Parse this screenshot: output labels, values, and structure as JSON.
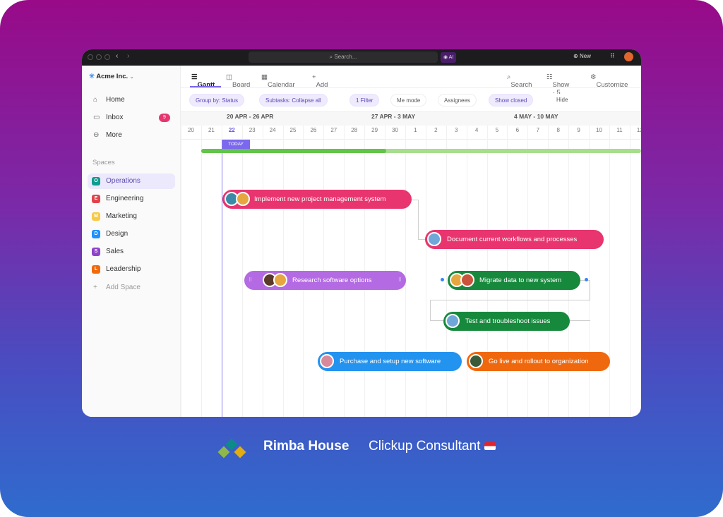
{
  "titlebar": {
    "search_placeholder": "Search...",
    "ai_label": "AI",
    "new_label": "New"
  },
  "workspace": {
    "name": "Acme Inc."
  },
  "nav": [
    {
      "label": "Home",
      "icon": "home-icon"
    },
    {
      "label": "Inbox",
      "icon": "inbox-icon",
      "badge": "9"
    },
    {
      "label": "More",
      "icon": "more-icon"
    }
  ],
  "spaces": {
    "heading": "Spaces",
    "items": [
      {
        "letter": "O",
        "label": "Operations",
        "color": "#0f9d8f",
        "active": true
      },
      {
        "letter": "E",
        "label": "Engineering",
        "color": "#e2434b"
      },
      {
        "letter": "M",
        "label": "Marketing",
        "color": "#f7c948"
      },
      {
        "letter": "D",
        "label": "Design",
        "color": "#1e90ff"
      },
      {
        "letter": "S",
        "label": "Sales",
        "color": "#8e44c9"
      },
      {
        "letter": "L",
        "label": "Leadership",
        "color": "#f06a0d"
      }
    ],
    "add_label": "Add Space"
  },
  "views": {
    "tabs": [
      "Gantt",
      "Board",
      "Calendar"
    ],
    "add_label": "Add",
    "search_label": "Search",
    "show_label": "Show · 5",
    "customize_label": "Customize"
  },
  "filters": {
    "group_by": "Group by: Status",
    "subtasks": "Subtasks: Collapse all",
    "filter": "1 Filter",
    "me_mode": "Me mode",
    "assignees": "Assignees",
    "show_closed": "Show closed",
    "hide": "Hide"
  },
  "timeline": {
    "weeks": [
      "20 APR - 26 APR",
      "27 APR - 3 MAY",
      "4 MAY - 10 MAY"
    ],
    "days": [
      "20",
      "21",
      "22",
      "23",
      "24",
      "25",
      "26",
      "27",
      "28",
      "29",
      "30",
      "1",
      "2",
      "3",
      "4",
      "5",
      "6",
      "7",
      "8",
      "9",
      "10",
      "11",
      "12"
    ],
    "today_label": "TODAY",
    "today": "22"
  },
  "tasks": [
    {
      "name": "Implement new project management system",
      "color": "#e8356f"
    },
    {
      "name": "Document current workflows and processes",
      "color": "#e8356f"
    },
    {
      "name": "Research software options",
      "color": "#b36ae2"
    },
    {
      "name": "Migrate data to new system",
      "color": "#17893d"
    },
    {
      "name": "Test and troubleshoot issues",
      "color": "#17893d"
    },
    {
      "name": "Purchase and setup new software",
      "color": "#2393f0"
    },
    {
      "name": "Go live and rollout to organization",
      "color": "#f0680e"
    }
  ],
  "footer": {
    "brand": "Rimba House",
    "tagline": "Clickup Consultant"
  }
}
